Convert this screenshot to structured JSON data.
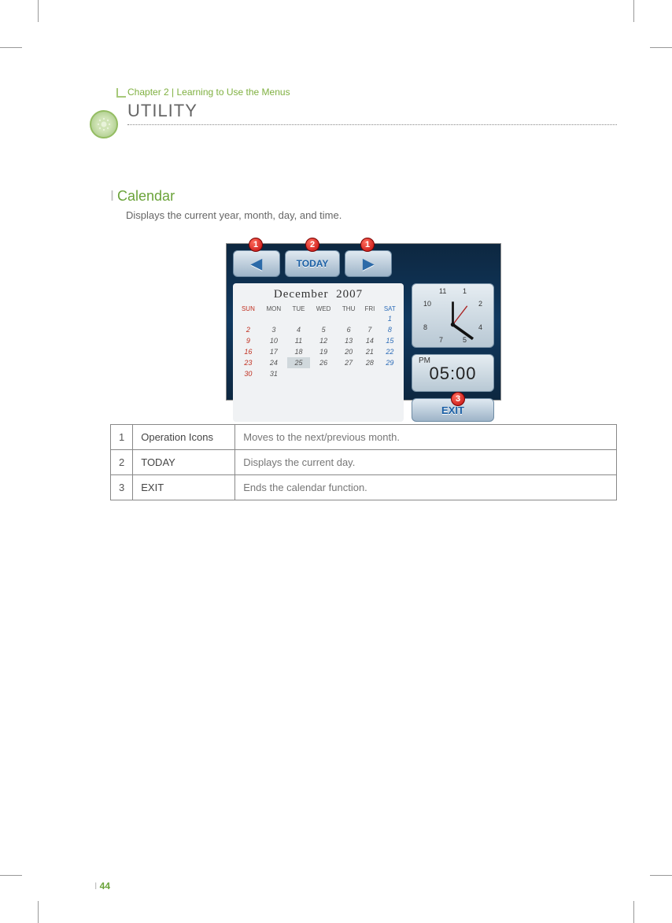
{
  "chapter": "Chapter 2 | Learning to Use the Menus",
  "section": "UTILITY",
  "subsection": {
    "title": "Calendar",
    "desc": "Displays the current year, month, day, and time."
  },
  "screenshot": {
    "today_btn": "TODAY",
    "exit_btn": "EXIT",
    "month": "December",
    "year": "2007",
    "weekdays": {
      "sun": "SUN",
      "mon": "MON",
      "tue": "TUE",
      "wed": "WED",
      "thu": "THU",
      "fri": "FRI",
      "sat": "SAT"
    },
    "ampm": "PM",
    "time": "05:00",
    "clock_numbers": {
      "n11": "11",
      "n1": "1",
      "n2": "2",
      "n4": "4",
      "n5": "5",
      "n7": "7",
      "n8": "8",
      "n10": "10"
    },
    "callouts": {
      "c1": "1",
      "c2": "2",
      "c3": "1",
      "c4": "3"
    },
    "days": {
      "r1": {
        "sat": "1"
      },
      "r2": {
        "sun": "2",
        "mon": "3",
        "tue": "4",
        "wed": "5",
        "thu": "6",
        "fri": "7",
        "sat": "8"
      },
      "r3": {
        "sun": "9",
        "mon": "10",
        "tue": "11",
        "wed": "12",
        "thu": "13",
        "fri": "14",
        "sat": "15"
      },
      "r4": {
        "sun": "16",
        "mon": "17",
        "tue": "18",
        "wed": "19",
        "thu": "20",
        "fri": "21",
        "sat": "22"
      },
      "r5": {
        "sun": "23",
        "mon": "24",
        "tue": "25",
        "wed": "26",
        "thu": "27",
        "fri": "28",
        "sat": "29"
      },
      "r6": {
        "sun": "30",
        "mon": "31"
      }
    }
  },
  "reftable": {
    "r1": {
      "num": "1",
      "name": "Operation Icons",
      "desc": "Moves to the next/previous month."
    },
    "r2": {
      "num": "2",
      "name": "TODAY",
      "desc": "Displays the current day."
    },
    "r3": {
      "num": "3",
      "name": "EXIT",
      "desc": "Ends the calendar function."
    }
  },
  "page_number": "44"
}
